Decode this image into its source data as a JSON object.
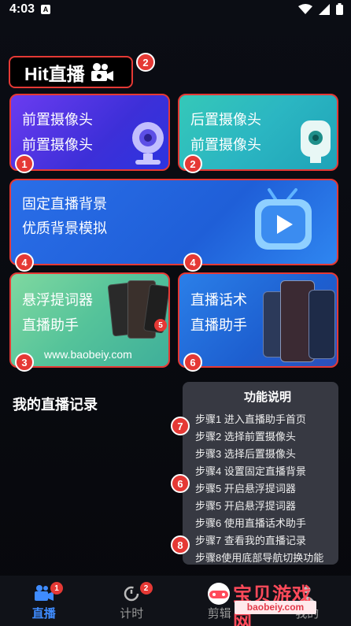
{
  "status": {
    "time": "4:03",
    "notif_icon": "A"
  },
  "header": {
    "title": "Hit直播",
    "title_icon": "video-camera-icon",
    "badge": "2"
  },
  "cards": {
    "front": {
      "line1": "前置摄像头",
      "line2": "前置摄像头",
      "badge": "1"
    },
    "back": {
      "line1": "后置摄像头",
      "line2": "前置摄像头",
      "badge": "2"
    },
    "background": {
      "line1": "固定直播背景",
      "line2": "优质背景模拟",
      "badge_left": "4",
      "badge_right": "4"
    },
    "float": {
      "line1": "悬浮提词器",
      "line2": "直播助手",
      "url": "www.baobeiy.com",
      "badge": "3",
      "inner_badge": "5"
    },
    "talk": {
      "line1": "直播话术",
      "line2": "直播助手",
      "badge": "6"
    }
  },
  "records": {
    "title": "我的直播记录"
  },
  "help": {
    "title": "功能说明",
    "steps": [
      "步骤1 进入直播助手首页",
      "步骤2 选择前置摄像头",
      "步骤3 选择后置摄像头",
      "步骤4 设置固定直播背景",
      "步骤5 开启悬浮提词器",
      "步骤5 开启悬浮提词器",
      "步骤6 使用直播话术助手",
      "步骤7 查看我的直播记录",
      "步骤8使用底部导航切换功能"
    ],
    "badges": [
      "7",
      "6",
      "8"
    ]
  },
  "tabbar": {
    "tabs": [
      {
        "label": "直播",
        "icon": "live-camera-icon",
        "badge": "1",
        "active": true
      },
      {
        "label": "计时",
        "icon": "timer-icon",
        "badge": "2",
        "active": false
      },
      {
        "label": "剪辑",
        "icon": "scissors-icon",
        "badge": "",
        "active": false
      },
      {
        "label": "我的",
        "icon": "profile-icon",
        "badge": "",
        "active": false
      }
    ]
  },
  "watermark": {
    "text": "宝贝游戏网",
    "url": "baobeiy.com"
  },
  "colors": {
    "accent": "#3f8cff",
    "badge_red": "#e53935"
  }
}
